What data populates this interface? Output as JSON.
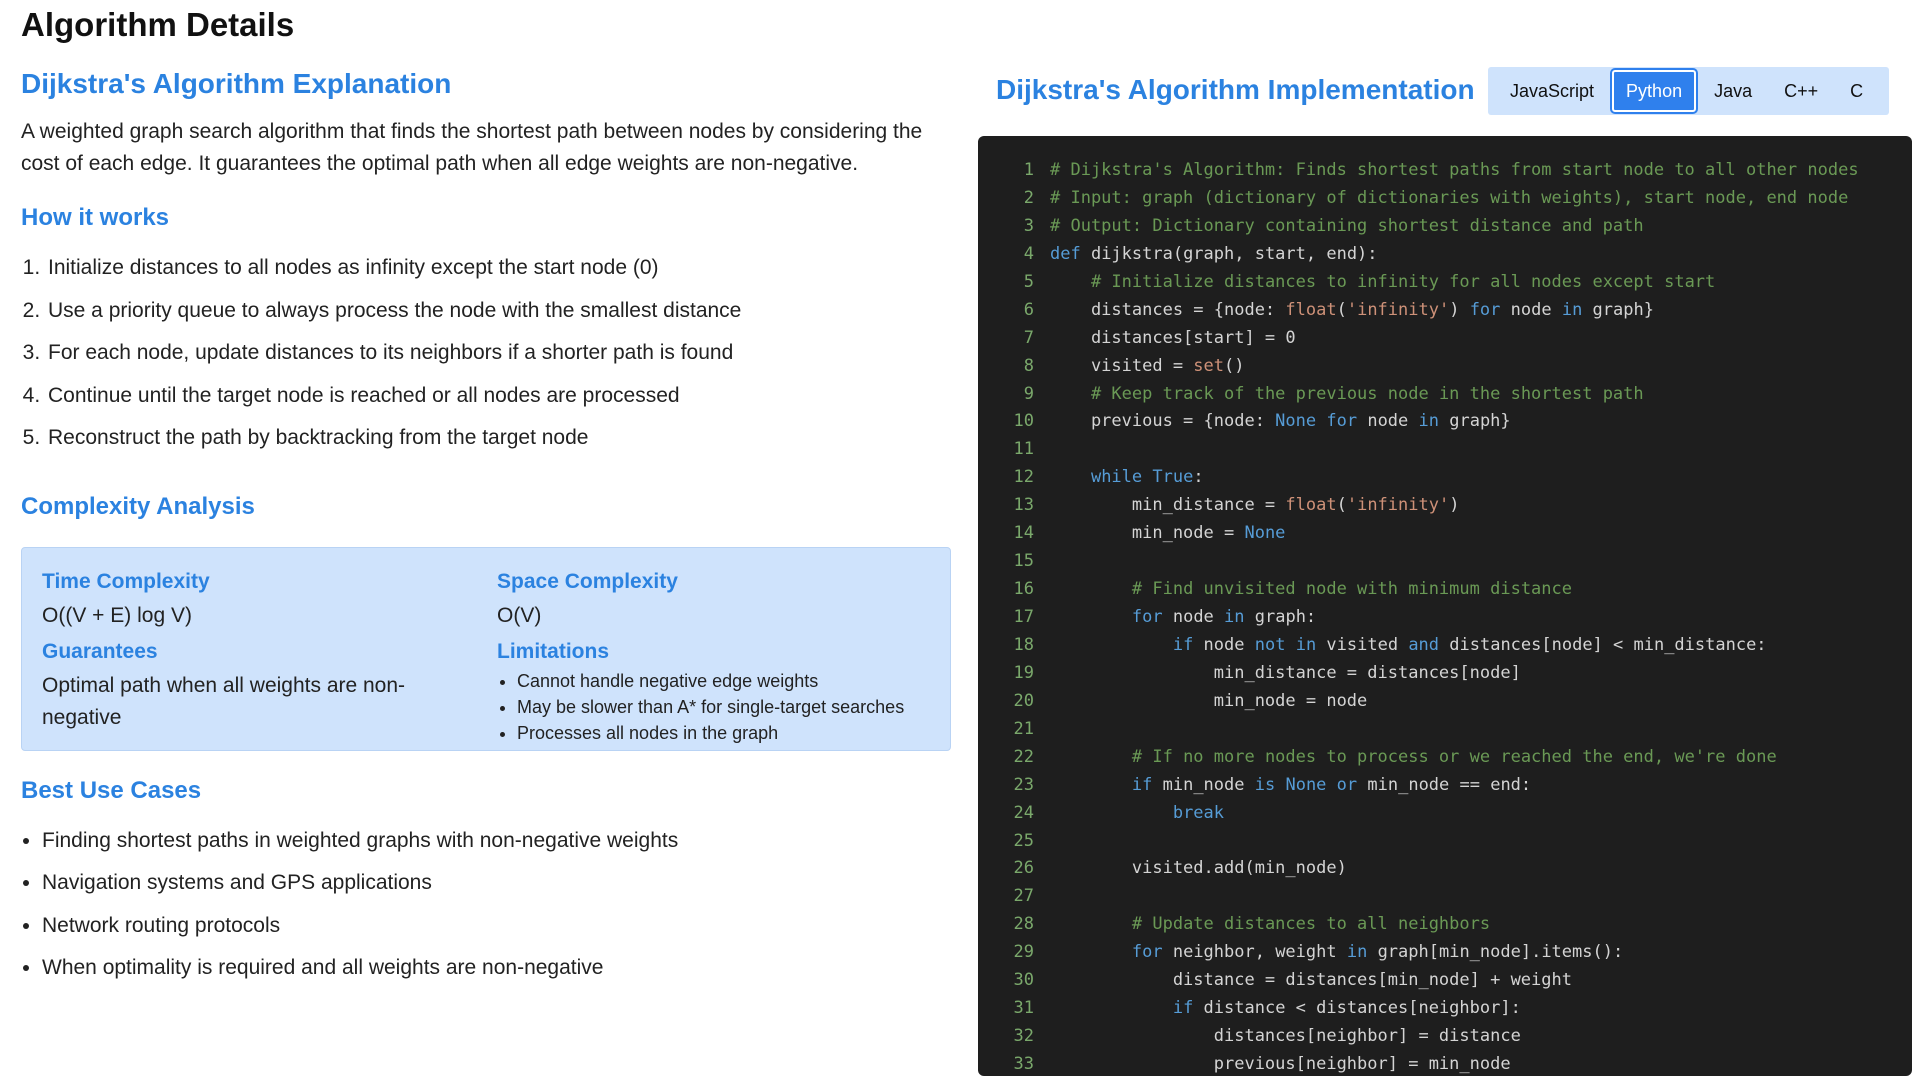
{
  "page": {
    "title": "Algorithm Details"
  },
  "left": {
    "explanation_title": "Dijkstra's Algorithm Explanation",
    "description": "A weighted graph search algorithm that finds the shortest path between nodes by considering the cost of each edge. It guarantees the optimal path when all edge weights are non-negative.",
    "how_title": "How it works",
    "steps": [
      "Initialize distances to all nodes as infinity except the start node (0)",
      "Use a priority queue to always process the node with the smallest distance",
      "For each node, update distances to its neighbors if a shorter path is found",
      "Continue until the target node is reached or all nodes are processed",
      "Reconstruct the path by backtracking from the target node"
    ],
    "complexity_title": "Complexity Analysis",
    "complexity": {
      "time_label": "Time Complexity",
      "time_value": "O((V + E) log V)",
      "space_label": "Space Complexity",
      "space_value": "O(V)",
      "guarantees_label": "Guarantees",
      "guarantees_value": "Optimal path when all weights are non-negative",
      "limitations_label": "Limitations",
      "limitations": [
        "Cannot handle negative edge weights",
        "May be slower than A* for single-target searches",
        "Processes all nodes in the graph"
      ]
    },
    "best_title": "Best Use Cases",
    "use_cases": [
      "Finding shortest paths in weighted graphs with non-negative weights",
      "Navigation systems and GPS applications",
      "Network routing protocols",
      "When optimality is required and all weights are non-negative"
    ]
  },
  "right": {
    "implementation_title": "Dijkstra's Algorithm Implementation",
    "tabs": [
      {
        "label": "JavaScript",
        "active": false
      },
      {
        "label": "Python",
        "active": true
      },
      {
        "label": "Java",
        "active": false
      },
      {
        "label": "C++",
        "active": false
      },
      {
        "label": "C",
        "active": false
      }
    ],
    "code_lines": [
      "# Dijkstra's Algorithm: Finds shortest paths from start node to all other nodes",
      "# Input: graph (dictionary of dictionaries with weights), start node, end node",
      "# Output: Dictionary containing shortest distance and path",
      "def dijkstra(graph, start, end):",
      "    # Initialize distances to infinity for all nodes except start",
      "    distances = {node: float('infinity') for node in graph}",
      "    distances[start] = 0",
      "    visited = set()",
      "    # Keep track of the previous node in the shortest path",
      "    previous = {node: None for node in graph}",
      "",
      "    while True:",
      "        min_distance = float('infinity')",
      "        min_node = None",
      "",
      "        # Find unvisited node with minimum distance",
      "        for node in graph:",
      "            if node not in visited and distances[node] < min_distance:",
      "                min_distance = distances[node]",
      "                min_node = node",
      "",
      "        # If no more nodes to process or we reached the end, we're done",
      "        if min_node is None or min_node == end:",
      "            break",
      "",
      "        visited.add(min_node)",
      "",
      "        # Update distances to all neighbors",
      "        for neighbor, weight in graph[min_node].items():",
      "            distance = distances[min_node] + weight",
      "            if distance < distances[neighbor]:",
      "                distances[neighbor] = distance",
      "                previous[neighbor] = min_node"
    ]
  }
}
